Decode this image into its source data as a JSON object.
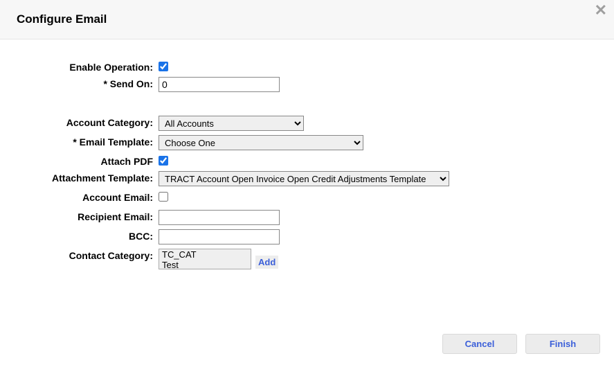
{
  "header": {
    "title": "Configure Email"
  },
  "labels": {
    "enable_operation": "Enable Operation:",
    "send_on": "* Send On:",
    "account_category": "Account Category:",
    "email_template": "* Email Template:",
    "attach_pdf": "Attach PDF",
    "attachment_template": "Attachment Template:",
    "account_email": "Account Email:",
    "recipient_email": "Recipient Email:",
    "bcc": "BCC:",
    "contact_category": "Contact Category:"
  },
  "fields": {
    "enable_operation_checked": true,
    "send_on_value": "0",
    "account_category_selected": "All Accounts",
    "email_template_selected": "Choose One",
    "attach_pdf_checked": true,
    "attachment_template_selected": "TRACT Account Open Invoice Open Credit Adjustments Template",
    "account_email_checked": false,
    "recipient_email_value": "",
    "bcc_value": "",
    "contact_category_options": [
      "TC_CAT",
      "Test"
    ]
  },
  "actions": {
    "add": "Add",
    "cancel": "Cancel",
    "finish": "Finish"
  }
}
